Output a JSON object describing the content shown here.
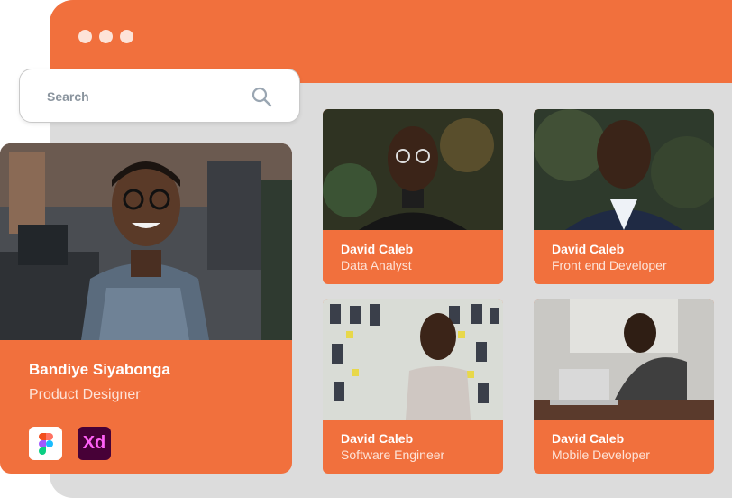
{
  "search": {
    "placeholder": "Search",
    "icon": "search-icon"
  },
  "featured": {
    "name": "Bandiye Siyabonga",
    "role": "Product Designer",
    "tools": [
      "figma-icon",
      "adobe-xd-icon"
    ],
    "xd_label": "Xd"
  },
  "profiles": [
    {
      "name": "David Caleb",
      "role": "Data Analyst"
    },
    {
      "name": "David Caleb",
      "role": "Front end Developer"
    },
    {
      "name": "David Caleb",
      "role": "Software Engineer"
    },
    {
      "name": "David Caleb",
      "role": "Mobile Developer"
    }
  ],
  "colors": {
    "accent": "#f1703d",
    "window_bg": "#dcdcdc"
  }
}
